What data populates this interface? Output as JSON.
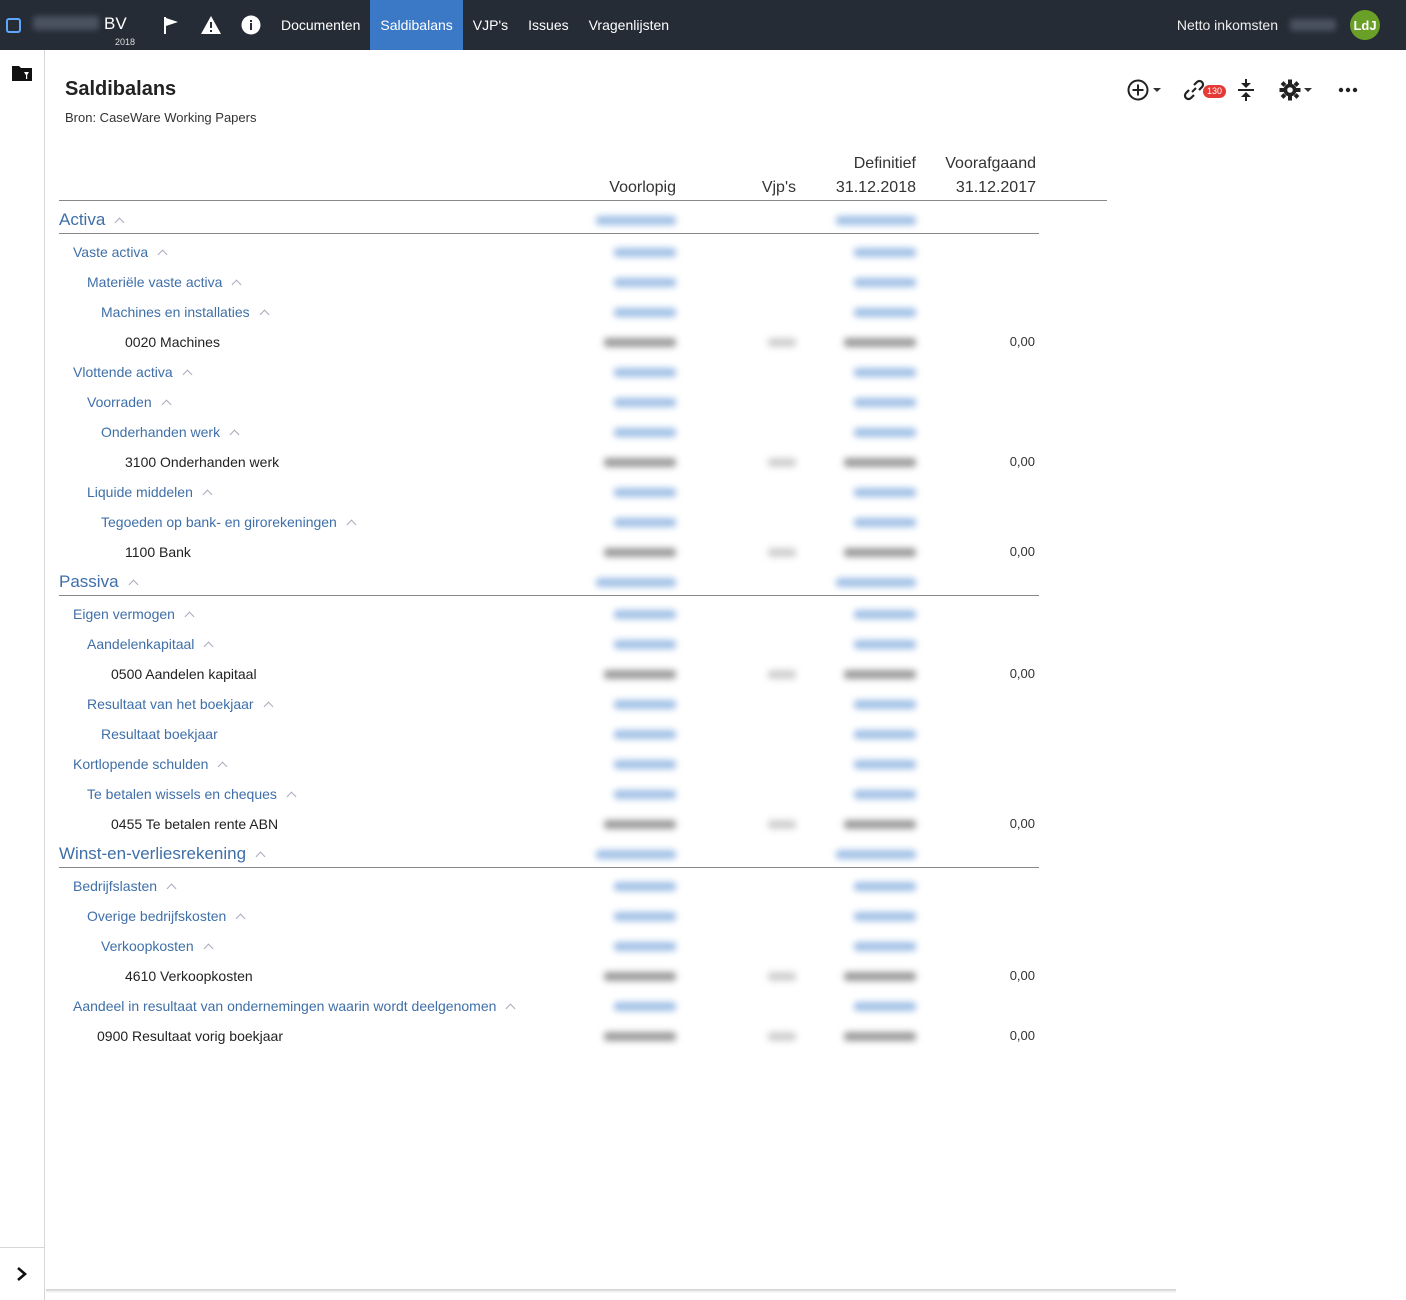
{
  "topbar": {
    "company_suffix": "BV",
    "year": "2018",
    "nav": [
      "Documenten",
      "Saldibalans",
      "VJP's",
      "Issues",
      "Vragenlijsten"
    ],
    "active_tab": "Saldibalans",
    "netto_label": "Netto inkomsten",
    "avatar_initials": "LdJ",
    "icons": [
      "app-logo-icon",
      "flag-icon",
      "warning-icon",
      "info-icon"
    ]
  },
  "page": {
    "title": "Saldibalans",
    "source": "Bron: CaseWare Working Papers",
    "link_badge": "130"
  },
  "columns": {
    "voorlopig": "Voorlopig",
    "vjps": "Vjp's",
    "definitief_line1": "Definitief",
    "definitief_line2": "31.12.2018",
    "voorafgaand_line1": "Voorafgaand",
    "voorafgaand_line2": "31.12.2017"
  },
  "rows": [
    {
      "label": "Activa",
      "type": "section"
    },
    {
      "label": "Vaste activa",
      "type": "group"
    },
    {
      "label": "Materiële vaste activa",
      "type": "group"
    },
    {
      "label": "Machines en installaties",
      "type": "group"
    },
    {
      "label": "0020 Machines",
      "type": "account",
      "prev": "0,00"
    },
    {
      "label": "Vlottende activa",
      "type": "group"
    },
    {
      "label": "Voorraden",
      "type": "group"
    },
    {
      "label": "Onderhanden werk",
      "type": "group"
    },
    {
      "label": "3100 Onderhanden werk",
      "type": "account",
      "prev": "0,00"
    },
    {
      "label": "Liquide middelen",
      "type": "group"
    },
    {
      "label": "Tegoeden op bank- en girorekeningen",
      "type": "group"
    },
    {
      "label": "1100 Bank",
      "type": "account",
      "prev": "0,00"
    },
    {
      "label": "Passiva",
      "type": "section"
    },
    {
      "label": "Eigen vermogen",
      "type": "group"
    },
    {
      "label": "Aandelenkapitaal",
      "type": "group"
    },
    {
      "label": "0500 Aandelen kapitaal",
      "type": "account",
      "prev": "0,00"
    },
    {
      "label": "Resultaat van het boekjaar",
      "type": "group"
    },
    {
      "label": "Resultaat boekjaar",
      "type": "group",
      "no_chevron": true
    },
    {
      "label": "Kortlopende schulden",
      "type": "group"
    },
    {
      "label": "Te betalen wissels en cheques",
      "type": "group"
    },
    {
      "label": "0455 Te betalen rente ABN",
      "type": "account",
      "prev": "0,00"
    },
    {
      "label": "Winst-en-verliesrekening",
      "type": "section"
    },
    {
      "label": "Bedrijfslasten",
      "type": "group"
    },
    {
      "label": "Overige bedrijfskosten",
      "type": "group"
    },
    {
      "label": "Verkoopkosten",
      "type": "group"
    },
    {
      "label": "4610 Verkoopkosten",
      "type": "account",
      "prev": "0,00"
    },
    {
      "label": "Aandeel in resultaat van ondernemingen waarin wordt deelgenomen",
      "type": "group"
    },
    {
      "label": "0900 Resultaat vorig boekjaar",
      "type": "account",
      "prev": "0,00"
    }
  ]
}
